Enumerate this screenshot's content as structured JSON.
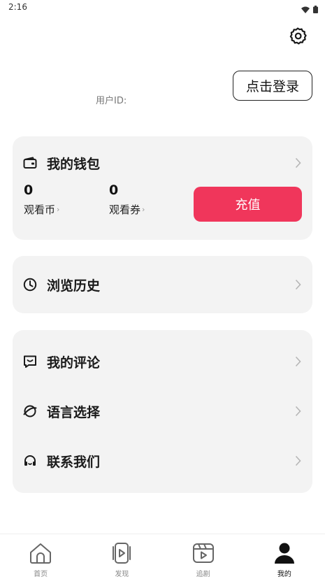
{
  "status_bar": {
    "time": "2:16"
  },
  "header": {
    "login_label": "点击登录",
    "user_id_label": "用户ID:"
  },
  "wallet": {
    "title": "我的钱包",
    "coins_value": "0",
    "coins_label": "观看币",
    "coupons_value": "0",
    "coupons_label": "观看券",
    "recharge_label": "充值"
  },
  "history": {
    "label": "浏览历史"
  },
  "menu": {
    "items": [
      {
        "label": "我的评论",
        "icon": "comment-icon"
      },
      {
        "label": "语言选择",
        "icon": "globe-icon"
      },
      {
        "label": "联系我们",
        "icon": "headset-icon"
      }
    ]
  },
  "tabbar": {
    "tabs": [
      {
        "label": "首页",
        "icon": "home-icon"
      },
      {
        "label": "发现",
        "icon": "discover-icon"
      },
      {
        "label": "追剧",
        "icon": "series-icon"
      },
      {
        "label": "我的",
        "icon": "profile-icon",
        "active": true
      }
    ]
  },
  "colors": {
    "accent": "#f0365b",
    "card_bg": "#f3f3f3"
  }
}
